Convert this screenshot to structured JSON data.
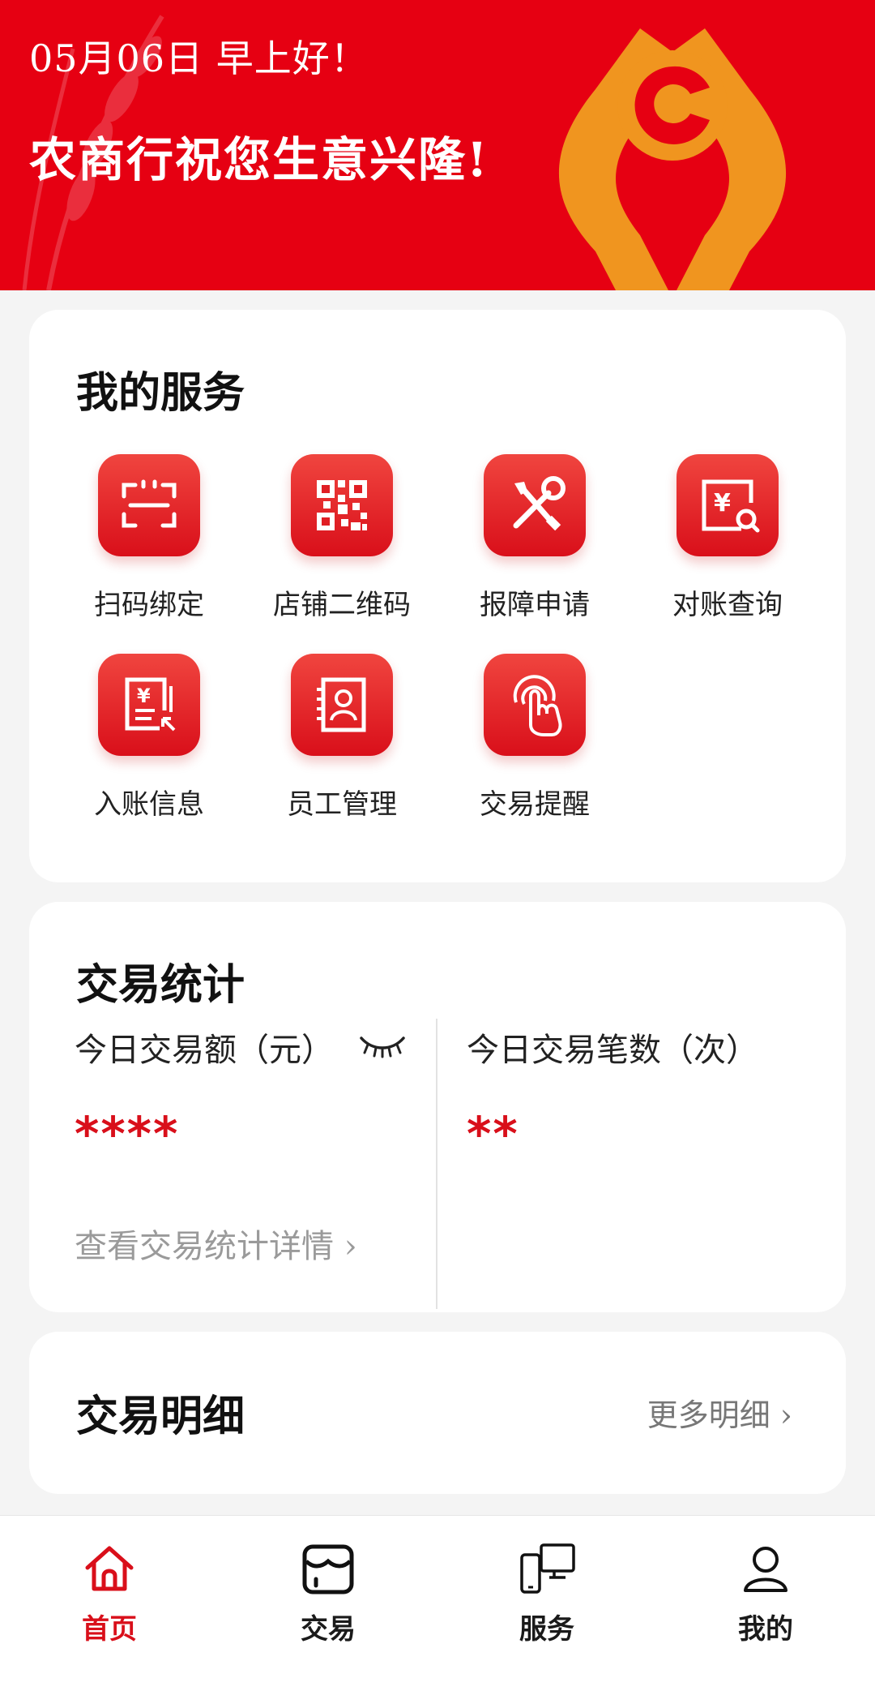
{
  "banner": {
    "date_greeting": "05月06日 早上好！",
    "slogan": "农商行祝您生意兴隆!"
  },
  "services": {
    "title": "我的服务",
    "items": [
      {
        "label": "扫码绑定",
        "icon": "scan-icon"
      },
      {
        "label": "店铺二维码",
        "icon": "qrcode-icon"
      },
      {
        "label": "报障申请",
        "icon": "tools-icon"
      },
      {
        "label": "对账查询",
        "icon": "reconcile-search-icon"
      },
      {
        "label": "入账信息",
        "icon": "receipt-icon"
      },
      {
        "label": "员工管理",
        "icon": "staff-icon"
      },
      {
        "label": "交易提醒",
        "icon": "touch-icon"
      }
    ]
  },
  "stats": {
    "title": "交易统计",
    "amount_label": "今日交易额（元）",
    "amount_value": "****",
    "count_label": "今日交易笔数（次）",
    "count_value": "**",
    "detail_link": "查看交易统计详情 ›"
  },
  "transactions": {
    "title": "交易明细",
    "more_link": "更多明细 ›"
  },
  "tabbar": {
    "items": [
      {
        "label": "首页",
        "icon": "home-icon",
        "active": true
      },
      {
        "label": "交易",
        "icon": "store-icon",
        "active": false
      },
      {
        "label": "服务",
        "icon": "devices-icon",
        "active": false
      },
      {
        "label": "我的",
        "icon": "user-icon",
        "active": false
      }
    ]
  },
  "colors": {
    "brand_red": "#e60012",
    "logo_orange": "#f0951f",
    "card_bg": "#ffffff",
    "page_bg": "#f4f4f4"
  }
}
